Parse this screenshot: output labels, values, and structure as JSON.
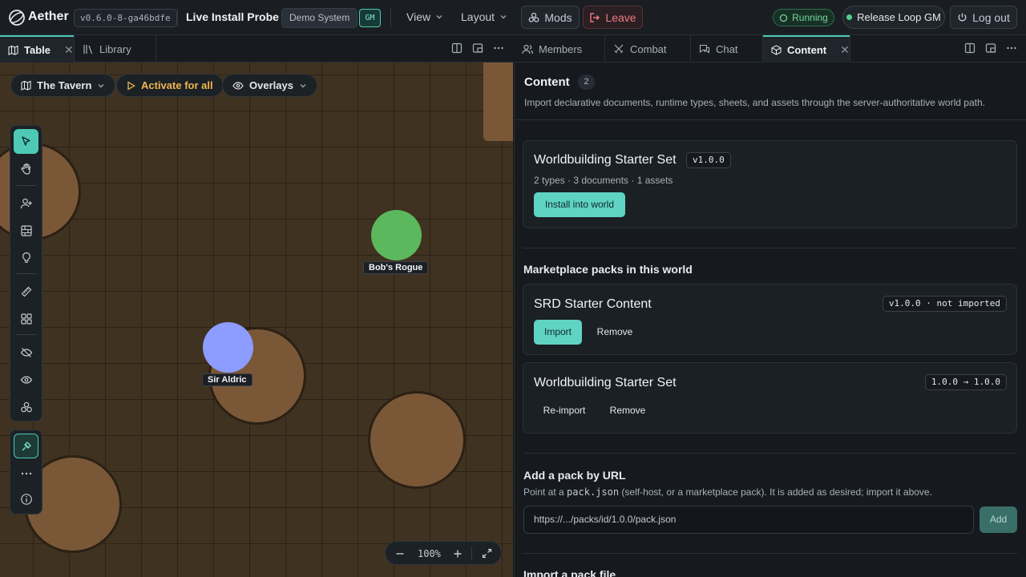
{
  "topbar": {
    "app_name": "Aether",
    "version": "v0.6.0-8-ga46bdfe",
    "world_title": "Live Install Probe",
    "system_badge": "Demo System",
    "role_badge": "GM",
    "menus": [
      "View",
      "Layout"
    ],
    "mods_label": "Mods",
    "leave_label": "Leave",
    "status": "Running",
    "session_name": "Release Loop GM",
    "logout_label": "Log out"
  },
  "left_tabs": [
    {
      "label": "Table",
      "icon": "map-icon",
      "active": true,
      "closable": true
    },
    {
      "label": "Library",
      "icon": "library-icon",
      "active": false
    }
  ],
  "canvas": {
    "scene_name": "The Tavern",
    "activate_label": "Activate for all",
    "overlays_label": "Overlays",
    "tokens": [
      {
        "name": "Bob's Rogue",
        "color": "#5cb85c"
      },
      {
        "name": "Sir Aldric",
        "color": "#8c9cff"
      }
    ],
    "zoom": "100%",
    "tools": [
      "select-icon",
      "pan-hand-icon",
      "add-token-icon",
      "tile-icon",
      "light-icon",
      "measure-ruler-icon",
      "grid-icon",
      "hide-icon",
      "visibility-icon",
      "cluster-icon",
      "ping-icon",
      "more-icon",
      "info-icon"
    ]
  },
  "right_tabs": [
    {
      "label": "Members",
      "icon": "members-icon"
    },
    {
      "label": "Combat",
      "icon": "combat-icon"
    },
    {
      "label": "Chat",
      "icon": "chat-icon"
    },
    {
      "label": "Content",
      "icon": "package-icon",
      "active": true,
      "closable": true
    }
  ],
  "content": {
    "title": "Content",
    "count": "2",
    "description": "Import declarative documents, runtime types, sheets, and assets through the server-authoritative world path.",
    "featured": {
      "name": "Worldbuilding Starter Set",
      "version": "v1.0.0",
      "meta": "2 types · 3 documents · 1 assets",
      "action": "Install into world"
    },
    "marketplace_title": "Marketplace packs in this world",
    "packs": [
      {
        "name": "SRD Starter Content",
        "status": "v1.0.0 · not imported",
        "primary": "Import",
        "secondary": "Remove"
      },
      {
        "name": "Worldbuilding Starter Set",
        "status": "1.0.0 → 1.0.0",
        "primary": "Re-import",
        "secondary": "Remove"
      }
    ],
    "add_by_url": {
      "title": "Add a pack by URL",
      "desc_prefix": "Point at a ",
      "desc_code": "pack.json",
      "desc_suffix": " (self-host, or a marketplace pack). It is added as desired; import it above.",
      "value": "https://.../packs/id/1.0.0/pack.json",
      "button": "Add"
    },
    "import_file_title": "Import a pack file"
  },
  "colors": {
    "accent": "#4dc9b6",
    "danger": "#f07a80",
    "success": "#4fd18a",
    "warning": "#f0b64d"
  }
}
